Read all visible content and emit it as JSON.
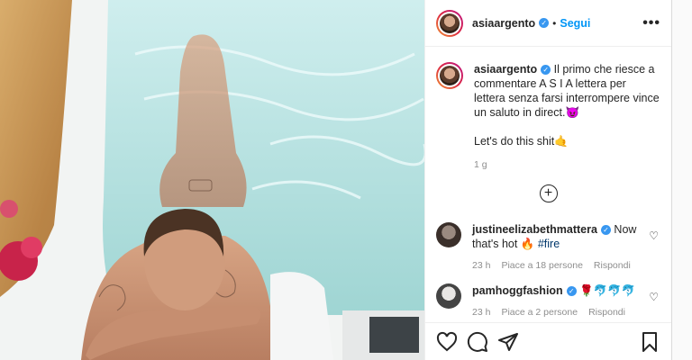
{
  "post": {
    "username": "asiaargento",
    "follow_label": "Segui",
    "more_label": "•••",
    "caption": "Il primo che riesce a commentare A S I A lettera per lettera senza farsi interrompere vince un saluto in direct.😈\n\nLet's do this shit🤙",
    "caption_time": "1 g",
    "load_more_label": "+",
    "comments": [
      {
        "username": "justineelizabethmattera",
        "text": " Now that's hot 🔥 ",
        "hashtag": "#fire",
        "time": "23 h",
        "likes": "Piace a 18 persone",
        "reply": "Rispondi"
      },
      {
        "username": "pamhoggfashion",
        "text": " 🌹🐬🐬🐬",
        "hashtag": "",
        "time": "23 h",
        "likes": "Piace a 2 persone",
        "reply": "Rispondi"
      }
    ]
  },
  "icons": {
    "verified": "verified-badge-icon",
    "like": "heart-icon",
    "comment": "comment-icon",
    "share": "send-icon",
    "save": "bookmark-icon"
  },
  "colors": {
    "link": "#0095f6",
    "verified": "#3897f0",
    "muted": "#8e8e8e"
  }
}
